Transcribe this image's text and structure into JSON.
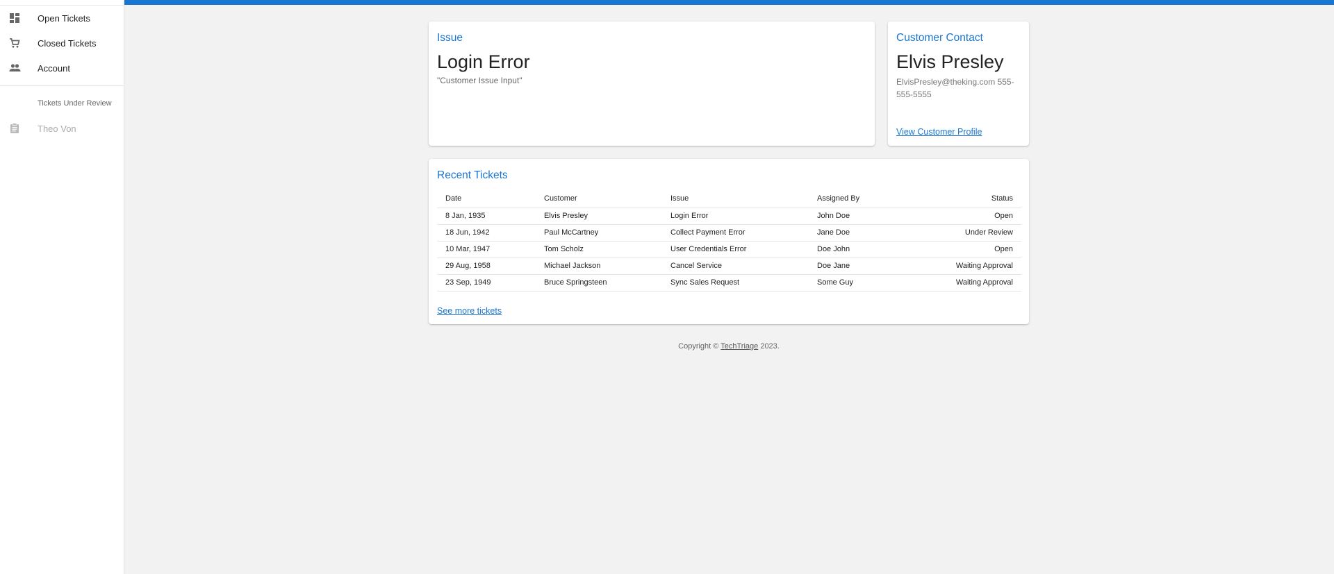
{
  "sidebar": {
    "items": [
      {
        "label": "Open Tickets",
        "icon": "dashboard-icon"
      },
      {
        "label": "Closed Tickets",
        "icon": "cart-icon"
      },
      {
        "label": "Account",
        "icon": "people-icon"
      }
    ],
    "subheader": "Tickets Under Review",
    "review_items": [
      {
        "label": "Theo Von",
        "icon": "clipboard-icon"
      }
    ]
  },
  "issue": {
    "title": "Issue",
    "heading": "Login Error",
    "description": "\"Customer Issue Input\""
  },
  "contact": {
    "title": "Customer Contact",
    "name": "Elvis Presley",
    "details": "ElvisPresley@theking.com 555-555-5555",
    "link": "View Customer Profile"
  },
  "tickets": {
    "title": "Recent Tickets",
    "columns": [
      "Date",
      "Customer",
      "Issue",
      "Assigned By",
      "Status"
    ],
    "rows": [
      [
        "8 Jan, 1935",
        "Elvis Presley",
        "Login Error",
        "John Doe",
        "Open"
      ],
      [
        "18 Jun, 1942",
        "Paul McCartney",
        "Collect Payment Error",
        "Jane Doe",
        "Under Review"
      ],
      [
        "10 Mar, 1947",
        "Tom Scholz",
        "User Credentials Error",
        "Doe John",
        "Open"
      ],
      [
        "29 Aug, 1958",
        "Michael Jackson",
        "Cancel Service",
        "Doe Jane",
        "Waiting Approval"
      ],
      [
        "23 Sep, 1949",
        "Bruce Springsteen",
        "Sync Sales Request",
        "Some Guy",
        "Waiting Approval"
      ]
    ],
    "see_more": "See more tickets"
  },
  "footer": {
    "prefix": "Copyright © ",
    "brand": "TechTriage",
    "suffix": " 2023."
  },
  "colors": {
    "accent": "#1976d2",
    "background": "#f2f2f2"
  }
}
